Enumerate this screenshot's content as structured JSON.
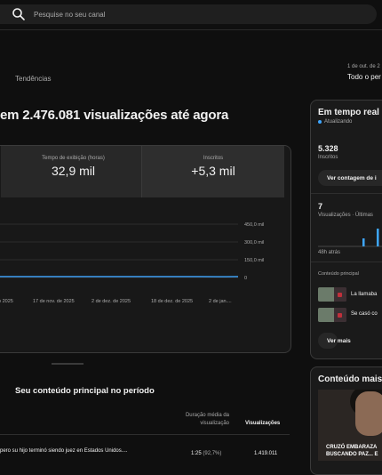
{
  "search": {
    "placeholder": "Pesquise no seu canal"
  },
  "tabs": {
    "trends": "Tendências"
  },
  "date_filter": {
    "range": "1 de out. de 2",
    "period": "Todo o per"
  },
  "headline": "em 2.476.081 visualizações até agora",
  "metrics": [
    {
      "label": "Tempo de exibição (horas)",
      "value": "32,9 mil"
    },
    {
      "label": "Inscritos",
      "value": "+5,3 mil"
    }
  ],
  "chart_data": {
    "type": "line",
    "y_ticks": [
      "450,0 mil",
      "300,0 mil",
      "150,0 mil",
      "0"
    ],
    "x_ticks": [
      "o 2025",
      "17 de nov. de 2025",
      "2 de dez. de 2025",
      "18 de dez. de 2025",
      "2 de jan...."
    ],
    "ylim": [
      0,
      450000
    ],
    "series": [
      {
        "values": [
          8000,
          8000,
          8500,
          8000,
          8200,
          8000,
          8300,
          8000,
          8100,
          8000,
          8200,
          7000,
          8000
        ]
      }
    ],
    "line_color": "#3ea6ff"
  },
  "content": {
    "title": "Seu conteúdo principal no período",
    "col_duration": "Duração média da visualização",
    "col_views": "Visualizações",
    "rows": [
      {
        "title": "pero su hijo terminó siendo juez en Estados Unidos....",
        "duration": "1:25",
        "pct": "(92,7%)",
        "views": "1.419.011"
      }
    ]
  },
  "realtime": {
    "title": "Em tempo real",
    "updating": "Atualizando",
    "subs_value": "5.328",
    "subs_label": "Inscritos",
    "count_button": "Ver contagem de i",
    "views_value": "7",
    "views_label": "Visualizações · Últimas",
    "hours_label": "48h atrás",
    "top_content_label": "Conteúdo principal",
    "videos": [
      {
        "title": "La llamaba"
      },
      {
        "title": "Se casó co"
      }
    ],
    "more_button": "Ver mais",
    "accent": "#3ea6ff"
  },
  "top_content": {
    "title": "Conteúdo mais r",
    "caption_line1": "CRUZÓ EMBARAZA",
    "caption_line2": "BUSCANDO PAZ... E"
  }
}
